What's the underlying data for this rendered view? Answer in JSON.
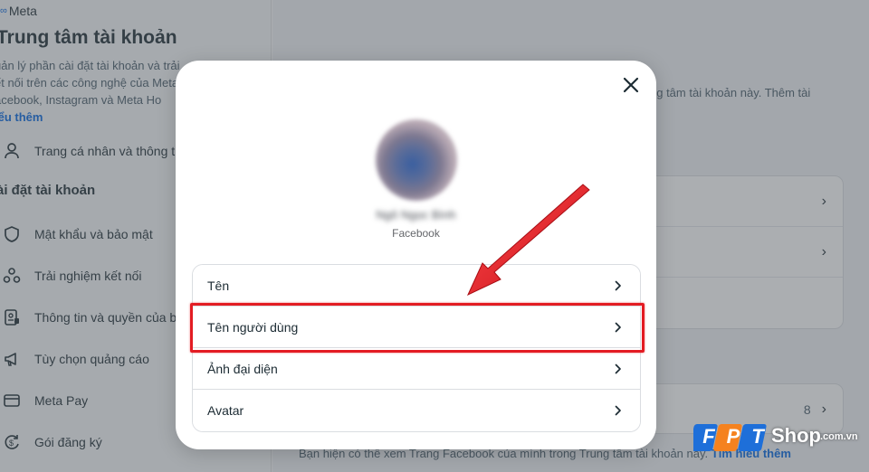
{
  "sidebar": {
    "brand": "Meta",
    "title": "Trung tâm tài khoản",
    "description_lines": [
      "uản lý phần cài đặt tài khoản và trải",
      "ết nối trên các công nghệ của Meta",
      "acebook, Instagram và Meta Ho"
    ],
    "learn_more": "iểu thêm",
    "profile_item": "Trang cá nhân và thông tin",
    "section_title": "ài đặt tài khoản",
    "items": [
      {
        "label": "Mật khẩu và bảo mật",
        "icon": "shield-icon"
      },
      {
        "label": "Trải nghiệm kết nối",
        "icon": "connected-icon"
      },
      {
        "label": "Thông tin và quyền của b",
        "icon": "id-card-icon"
      },
      {
        "label": "Tùy chọn quảng cáo",
        "icon": "megaphone-icon"
      },
      {
        "label": "Meta Pay",
        "icon": "card-icon"
      },
      {
        "label": "Gói đăng ký",
        "icon": "subscription-icon"
      }
    ]
  },
  "main": {
    "description": "ng tâm tài khoản này. Thêm tài",
    "count": "8",
    "bottom_text": "Bạn hiện có thể xem Trang Facebook của mình trong Trung tâm tài khoản này.",
    "bottom_link": "Tìm hiểu thêm"
  },
  "modal": {
    "profile_name": "Ngô Ngọc Bình",
    "platform": "Facebook",
    "options": [
      "Tên",
      "Tên người dùng",
      "Ảnh đại diện",
      "Avatar"
    ]
  },
  "watermark": {
    "brand_letters": "FPT",
    "shop": "Shop",
    "domain": ".com.vn",
    "colors": {
      "blue": "#1e6fd9",
      "orange": "#f5821f"
    }
  },
  "colors": {
    "accent": "#0064e0",
    "highlight": "#e31c23"
  }
}
